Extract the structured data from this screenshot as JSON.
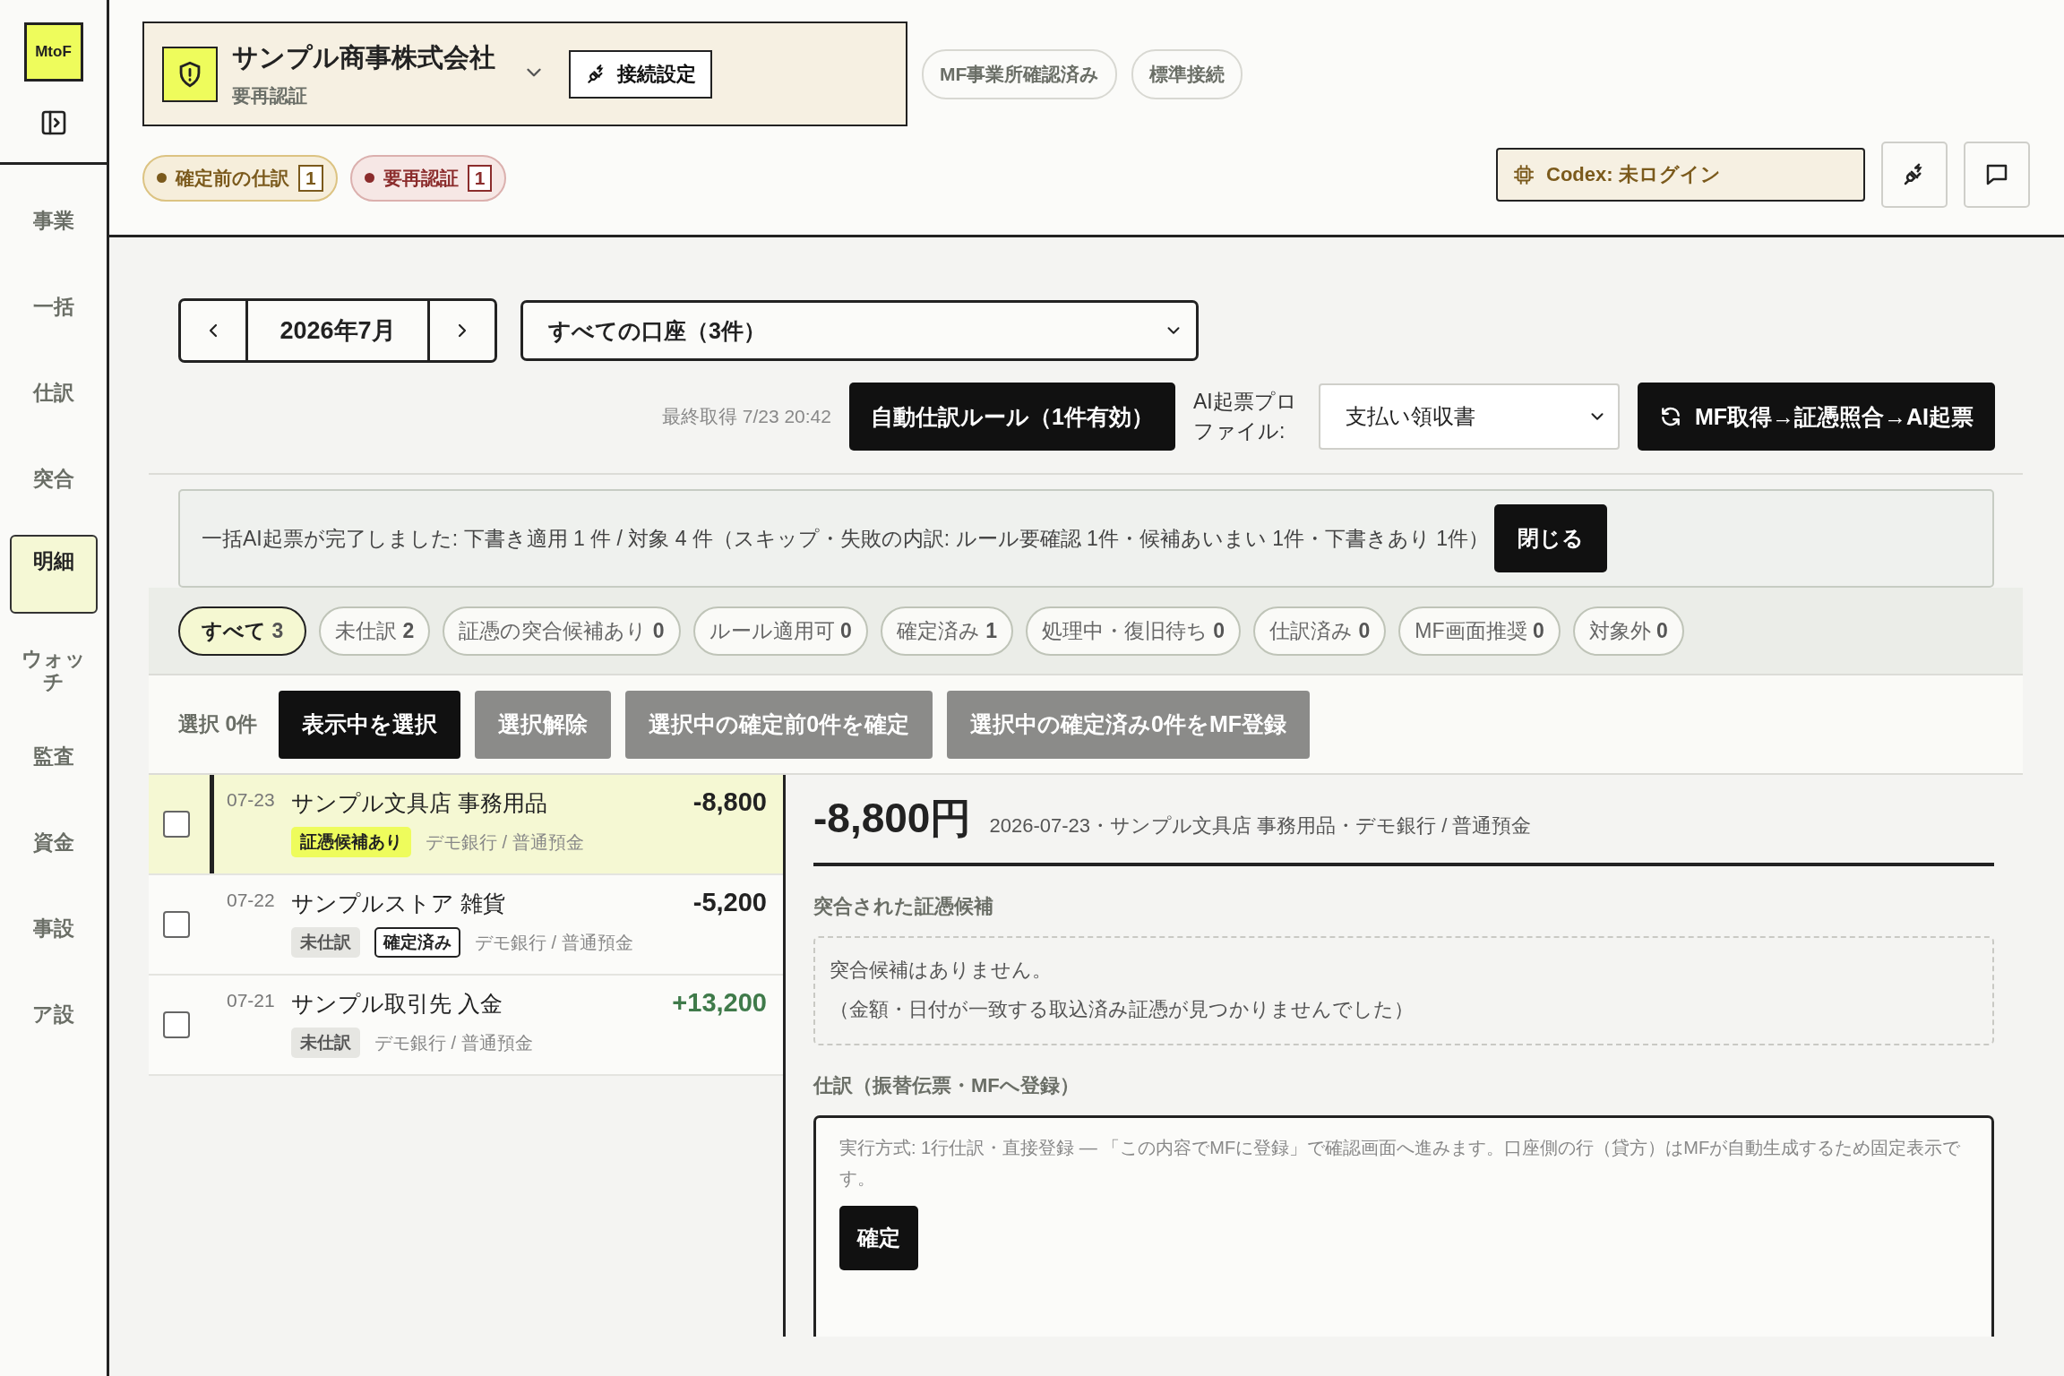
{
  "sidebar": {
    "logo": "MtoF",
    "items": [
      {
        "label": "事業",
        "selected": false
      },
      {
        "label": "一括",
        "selected": false
      },
      {
        "label": "仕訳",
        "selected": false
      },
      {
        "label": "突合",
        "selected": false
      },
      {
        "label": "明細",
        "selected": true
      },
      {
        "label": "ウォッチ",
        "selected": false
      },
      {
        "label": "監査",
        "selected": false
      },
      {
        "label": "資金",
        "selected": false
      },
      {
        "label": "事設",
        "selected": false
      },
      {
        "label": "ア設",
        "selected": false
      }
    ]
  },
  "header": {
    "company": {
      "name": "サンプル商事株式会社",
      "status": "要再認証",
      "connect_button": "接続設定"
    },
    "pills": [
      "MF事業所確認済み",
      "標準接続"
    ],
    "badges": [
      {
        "label": "確定前の仕訳",
        "count": "1",
        "kind": "warning"
      },
      {
        "label": "要再認証",
        "count": "1",
        "kind": "danger"
      }
    ],
    "codex_button": "Codex: 未ログイン"
  },
  "toolbar": {
    "month": "2026年7月",
    "account_select": "すべての口座（3件）",
    "last_fetch": "最終取得 7/23 20:42",
    "rule_button": "自動仕訳ルール（1件有効）",
    "profile_label": "AI起票プロファイル:",
    "profile_select": "支払い領収書",
    "run_button": "MF取得→証憑照合→AI起票"
  },
  "notice": {
    "text": "一括AI起票が完了しました: 下書き適用 1 件 / 対象 4 件（スキップ・失敗の内訳: ルール要確認 1件・候補あいまい 1件・下書きあり 1件）",
    "close_button": "閉じる"
  },
  "filters": [
    {
      "label": "すべて",
      "count": "3",
      "selected": true
    },
    {
      "label": "未仕訳",
      "count": "2",
      "selected": false
    },
    {
      "label": "証憑の突合候補あり",
      "count": "0",
      "selected": false
    },
    {
      "label": "ルール適用可",
      "count": "0",
      "selected": false
    },
    {
      "label": "確定済み",
      "count": "1",
      "selected": false
    },
    {
      "label": "処理中・復旧待ち",
      "count": "0",
      "selected": false
    },
    {
      "label": "仕訳済み",
      "count": "0",
      "selected": false
    },
    {
      "label": "MF画面推奨",
      "count": "0",
      "selected": false
    },
    {
      "label": "対象外",
      "count": "0",
      "selected": false
    }
  ],
  "selection": {
    "count_label": "選択 0件",
    "buttons": [
      {
        "label": "表示中を選択",
        "disabled": false
      },
      {
        "label": "選択解除",
        "disabled": true
      },
      {
        "label": "選択中の確定前0件を確定",
        "disabled": true
      },
      {
        "label": "選択中の確定済み0件をMF登録",
        "disabled": true
      }
    ]
  },
  "transactions": [
    {
      "date": "07-23",
      "title": "サンプル文具店 事務用品",
      "amount": "-8,800",
      "kind": "expense",
      "checked": false,
      "selected": true,
      "tags": [
        {
          "label": "証憑候補あり",
          "kind": "candidate"
        }
      ],
      "account": "デモ銀行 / 普通預金"
    },
    {
      "date": "07-22",
      "title": "サンプルストア 雑貨",
      "amount": "-5,200",
      "kind": "expense",
      "checked": false,
      "selected": false,
      "tags": [
        {
          "label": "未仕訳",
          "kind": "unposted"
        },
        {
          "label": "確定済み",
          "kind": "confirmed"
        }
      ],
      "account": "デモ銀行 / 普通預金"
    },
    {
      "date": "07-21",
      "title": "サンプル取引先 入金",
      "amount": "+13,200",
      "kind": "income",
      "checked": false,
      "selected": false,
      "tags": [
        {
          "label": "未仕訳",
          "kind": "unposted"
        }
      ],
      "account": "デモ銀行 / 普通預金"
    }
  ],
  "detail": {
    "amount": "-8,800円",
    "meta": "2026-07-23・サンプル文具店 事務用品・デモ銀行 / 普通預金",
    "match_heading": "突合された証憑候補",
    "empty_lines": [
      "突合候補はありません。",
      "（金額・日付が一致する取込済み証憑が見つかりませんでした）"
    ],
    "journal_heading": "仕訳（振替伝票・MFへ登録）",
    "journal_note": "実行方式: 1行仕訳・直接登録 — 「この内容でMFに登録」で確認画面へ進みます。口座側の行（貸方）はMFが自動生成するため固定表示です。",
    "confirm_button": "確定"
  }
}
